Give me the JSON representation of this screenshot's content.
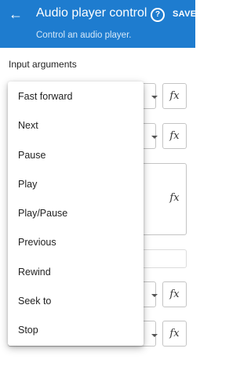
{
  "header": {
    "title": "Audio player control",
    "subtitle": "Control an audio player.",
    "save_label": "SAVE",
    "back_icon": "arrow-left-icon",
    "help_icon": "help-circle-icon",
    "help_glyph": "?",
    "color": "#1e7ccf"
  },
  "form": {
    "section_label": "Input arguments",
    "fx_label": "fx"
  },
  "menu": {
    "items": [
      "Fast forward",
      "Next",
      "Pause",
      "Play",
      "Play/Pause",
      "Previous",
      "Rewind",
      "Seek to",
      "Stop"
    ]
  }
}
